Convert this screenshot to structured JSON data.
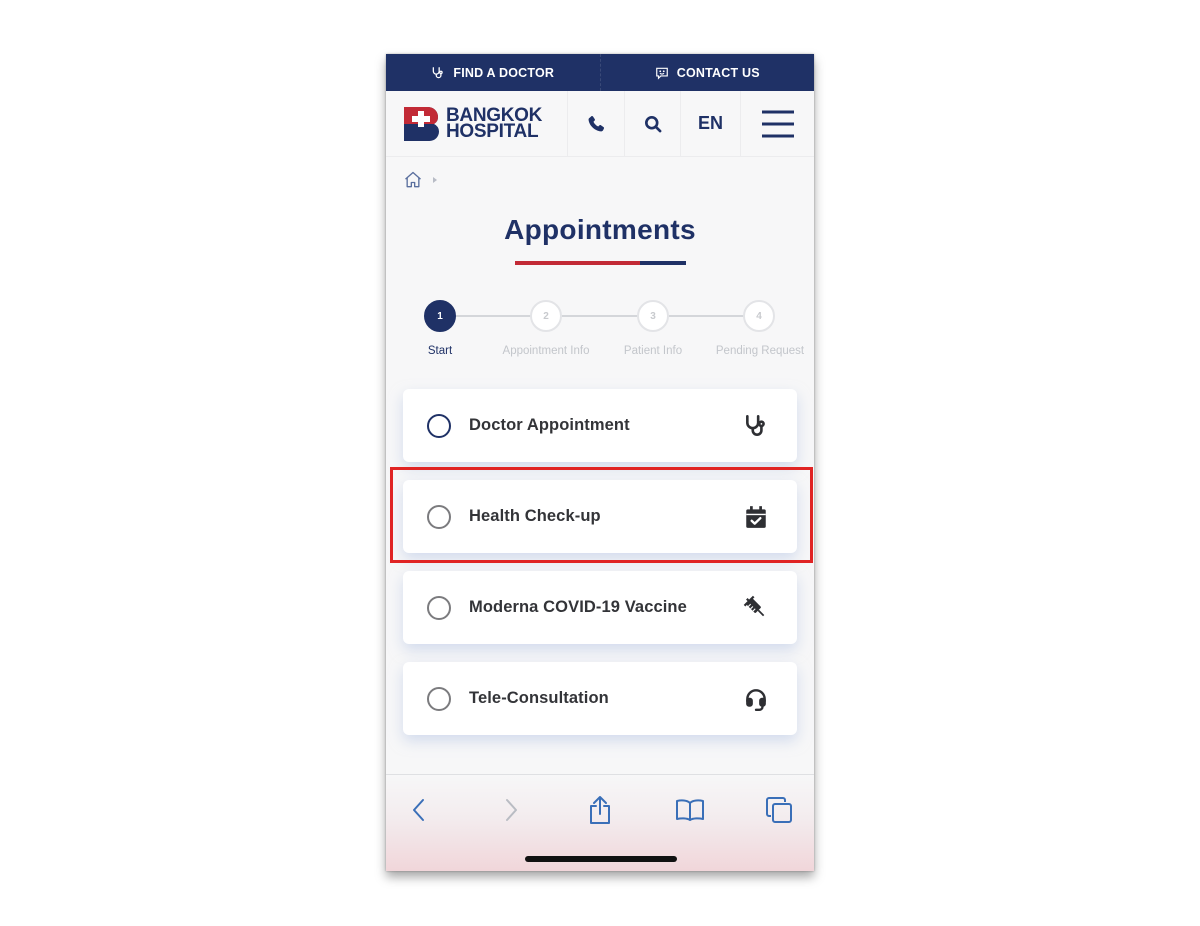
{
  "colors": {
    "brand_navy": "#1f3166",
    "brand_red": "#c22a36",
    "highlight_red": "#e02424",
    "text_dark": "#333438",
    "step_inactive": "#c3c6cb",
    "safari_blue": "#3a6fb8"
  },
  "topbar": {
    "find_doctor": {
      "label": "FIND A DOCTOR",
      "icon": "stethoscope-icon"
    },
    "contact_us": {
      "label": "CONTACT US",
      "icon": "chat-smile-icon"
    }
  },
  "header": {
    "logo": {
      "line1": "BANGKOK",
      "line2": "HOSPITAL"
    },
    "phone_icon": "phone-icon",
    "search_icon": "search-icon",
    "language": "EN",
    "menu_icon": "hamburger-icon"
  },
  "breadcrumb": {
    "home_icon": "home-icon"
  },
  "page": {
    "title": "Appointments"
  },
  "stepper": {
    "current_step": 1,
    "steps": [
      {
        "number": "1",
        "label": "Start",
        "active": true
      },
      {
        "number": "2",
        "label": "Appointment Info",
        "active": false
      },
      {
        "number": "3",
        "label": "Patient Info",
        "active": false
      },
      {
        "number": "4",
        "label": "Pending Request",
        "active": false
      }
    ]
  },
  "options": [
    {
      "label": "Doctor Appointment",
      "icon": "stethoscope-icon",
      "selected": false
    },
    {
      "label": "Health Check-up",
      "icon": "calendar-check-icon",
      "selected": false,
      "highlighted": true
    },
    {
      "label": "Moderna COVID-19 Vaccine",
      "icon": "syringe-icon",
      "selected": false
    },
    {
      "label": "Tele-Consultation",
      "icon": "headset-icon",
      "selected": false
    }
  ],
  "browser_toolbar": {
    "back": "chevron-left-icon",
    "forward": "chevron-right-icon",
    "share": "share-icon",
    "bookmarks": "book-icon",
    "tabs": "tabs-icon"
  }
}
